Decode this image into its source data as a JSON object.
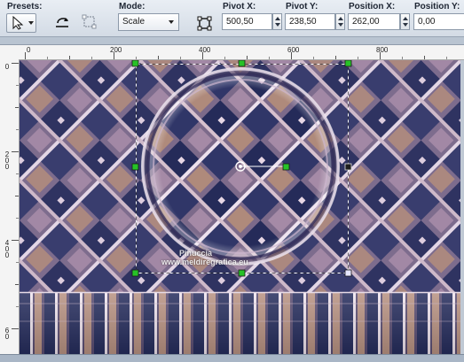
{
  "toolbar": {
    "presets_label": "Presets:",
    "mode_label": "Mode:",
    "mode_value": "Scale",
    "pivot_x_label": "Pivot X:",
    "pivot_x_value": "500,50",
    "pivot_y_label": "Pivot Y:",
    "pivot_y_value": "238,50",
    "position_x_label": "Position X:",
    "position_x_value": "262,00",
    "position_y_label": "Position Y:",
    "position_y_value": "0,00"
  },
  "ruler": {
    "top": [
      "0",
      "200",
      "400",
      "600",
      "800"
    ],
    "left": [
      "0",
      "2 0 0",
      "4 0 0",
      "6 0"
    ]
  },
  "watermark": {
    "line1": "Pinuccia",
    "line2": "www.meldiregrafica.eu"
  },
  "colors": {
    "accent_green": "#27c227",
    "toolbar_bg": "#dbe2ea",
    "navy": "#262f5f",
    "mauve": "#a98fa7",
    "tan": "#c4a58b"
  },
  "icons": [
    "pick-tool-icon",
    "reset-icon",
    "rotate-center-icon",
    "transform-icon"
  ]
}
